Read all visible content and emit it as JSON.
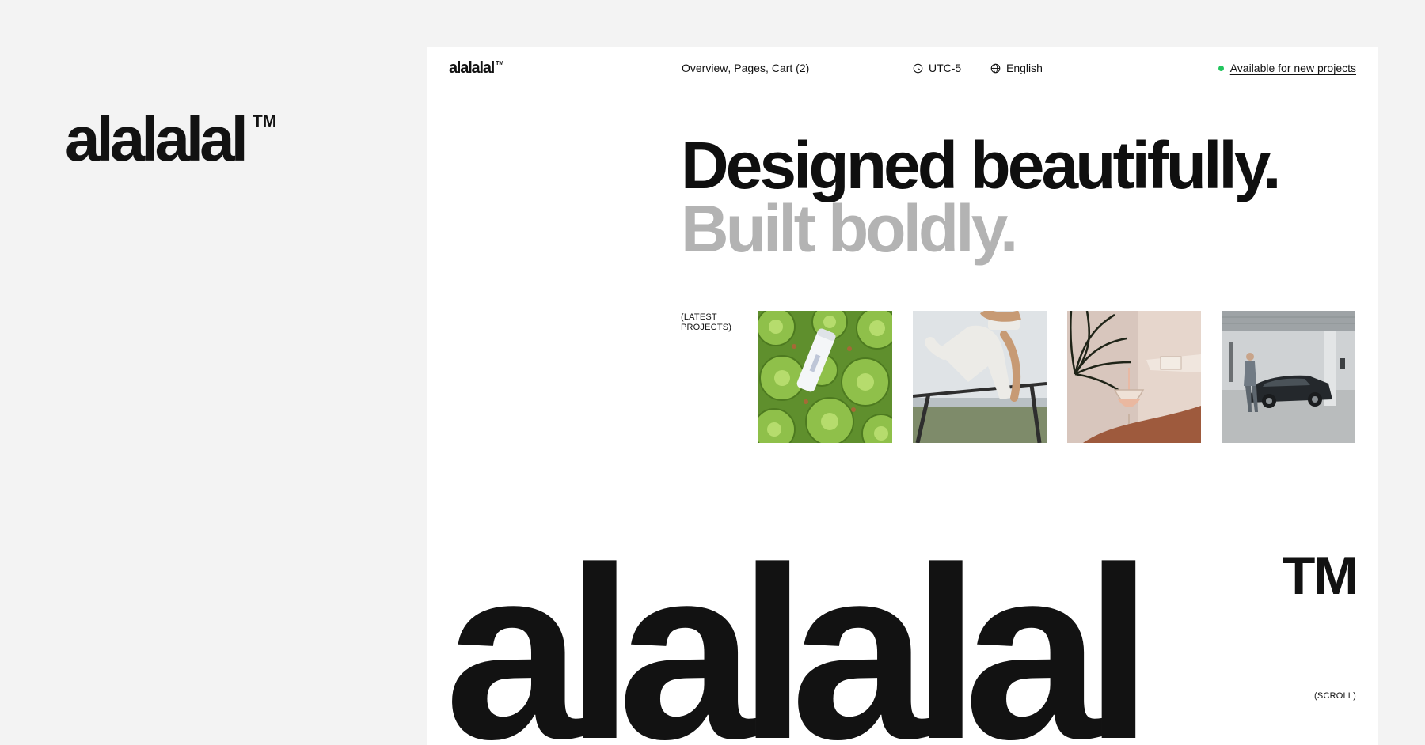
{
  "outer_logo": {
    "wordmark": "alalalal",
    "tm": "TM"
  },
  "header": {
    "brand": {
      "wordmark": "alalalal",
      "tm": "TM"
    },
    "nav": [
      {
        "label": "Overview",
        "sep": ","
      },
      {
        "label": "Pages",
        "sep": ","
      },
      {
        "label": "Cart (2)",
        "sep": ""
      }
    ],
    "clock": {
      "icon": "clock-icon",
      "label": "UTC-5"
    },
    "language": {
      "icon": "globe-icon",
      "label": "English"
    },
    "availability": {
      "label": "Available for new projects",
      "dot_color": "#22c55e"
    }
  },
  "hero": {
    "line1": "Designed beautifully.",
    "line2": "Built boldly."
  },
  "latest": {
    "label": "(LATEST PROJECTS)",
    "projects": [
      {
        "name": "succulents-bottle"
      },
      {
        "name": "fitness-stretch"
      },
      {
        "name": "wine-pour"
      },
      {
        "name": "car-garage"
      }
    ]
  },
  "footer": {
    "wordmark": "alalalal",
    "tm": "TM",
    "scroll_label": "(SCROLL)"
  },
  "colors": {
    "background": "#f3f3f3",
    "panel": "#ffffff",
    "text": "#121212",
    "muted_heading": "#b3b3b3",
    "accent_green": "#22c55e"
  }
}
